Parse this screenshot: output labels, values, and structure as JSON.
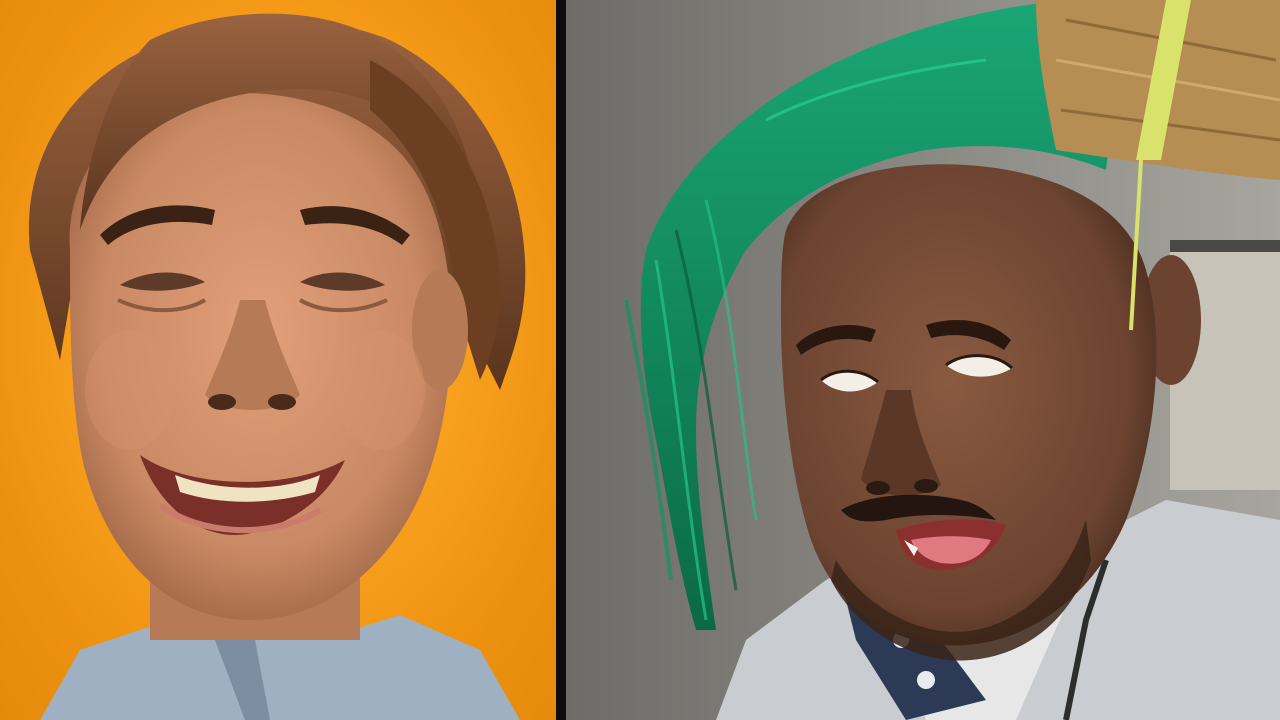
{
  "thumbnail": {
    "left_panel": {
      "subject": "smiling-man-face",
      "background_color": "#f39612",
      "skin_color": "#c98964",
      "hair_color": "#7a4a2a",
      "shirt_color": "#9fb0c2"
    },
    "right_panel": {
      "subject": "man-with-broom-hair",
      "background_color": "#7b7a76",
      "skin_color": "#6b4330",
      "broom_bristles_color": "#0f8a5c",
      "broom_straw_color": "#b68d52",
      "broom_band_color": "#d9e26a",
      "jacket_color": "#c9ccd0"
    },
    "divider_color": "#0c0c0c"
  }
}
